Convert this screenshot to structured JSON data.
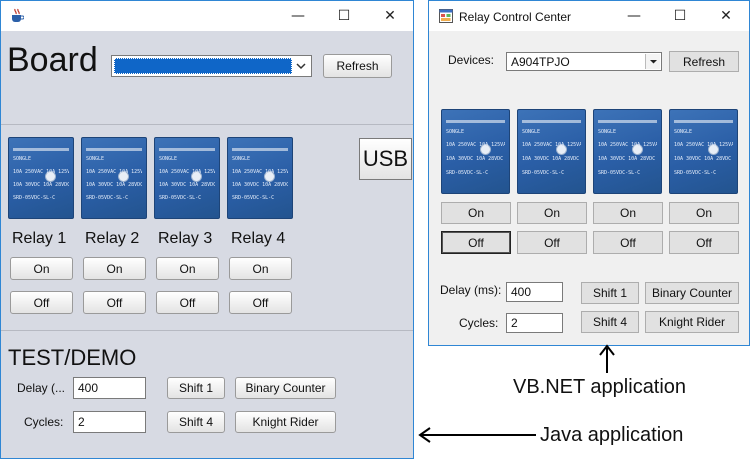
{
  "java": {
    "title_icon": "java-cup-icon",
    "title": "",
    "board_label": "Board",
    "board_select_value": "",
    "refresh_label": "Refresh",
    "usb_label": "USB",
    "relays": [
      {
        "name": "Relay 1",
        "on": "On",
        "off": "Off"
      },
      {
        "name": "Relay 2",
        "on": "On",
        "off": "Off"
      },
      {
        "name": "Relay 3",
        "on": "On",
        "off": "Off"
      },
      {
        "name": "Relay 4",
        "on": "On",
        "off": "Off"
      }
    ],
    "test_title": "TEST/DEMO",
    "delay_label": "Delay (...",
    "delay_value": "400",
    "cycles_label": "Cycles:",
    "cycles_value": "2",
    "shift1_label": "Shift 1",
    "shift4_label": "Shift 4",
    "binary_label": "Binary Counter",
    "knight_label": "Knight Rider"
  },
  "vb": {
    "title_icon": "app-form-icon",
    "title": "Relay Control Center",
    "devices_label": "Devices:",
    "devices_value": "A904TPJO",
    "refresh_label": "Refresh",
    "relays": [
      {
        "on": "On",
        "off": "Off"
      },
      {
        "on": "On",
        "off": "Off"
      },
      {
        "on": "On",
        "off": "Off"
      },
      {
        "on": "On",
        "off": "Off"
      }
    ],
    "delay_label": "Delay (ms):",
    "delay_value": "400",
    "cycles_label": "Cycles:",
    "cycles_value": "2",
    "shift1_label": "Shift 1",
    "shift4_label": "Shift 4",
    "binary_label": "Binary Counter",
    "knight_label": "Knight Rider"
  },
  "annotations": {
    "vb_caption": "VB.NET application",
    "java_caption": "Java application"
  },
  "window_controls": {
    "minimize": "—",
    "maximize": "☐",
    "close": "✕"
  },
  "relay_print": {
    "brand": "SONGLE",
    "model": "SRD-05VDC-SL-C",
    "rating1": "10A 250VAC 10A 125VAC",
    "rating2": "10A 30VDC 10A 28VDC"
  },
  "colors": {
    "java_bg": "#d7dae3",
    "vb_bg": "#f0f0f0",
    "select_highlight": "#0f66c8",
    "window_border": "#2f86d4"
  }
}
